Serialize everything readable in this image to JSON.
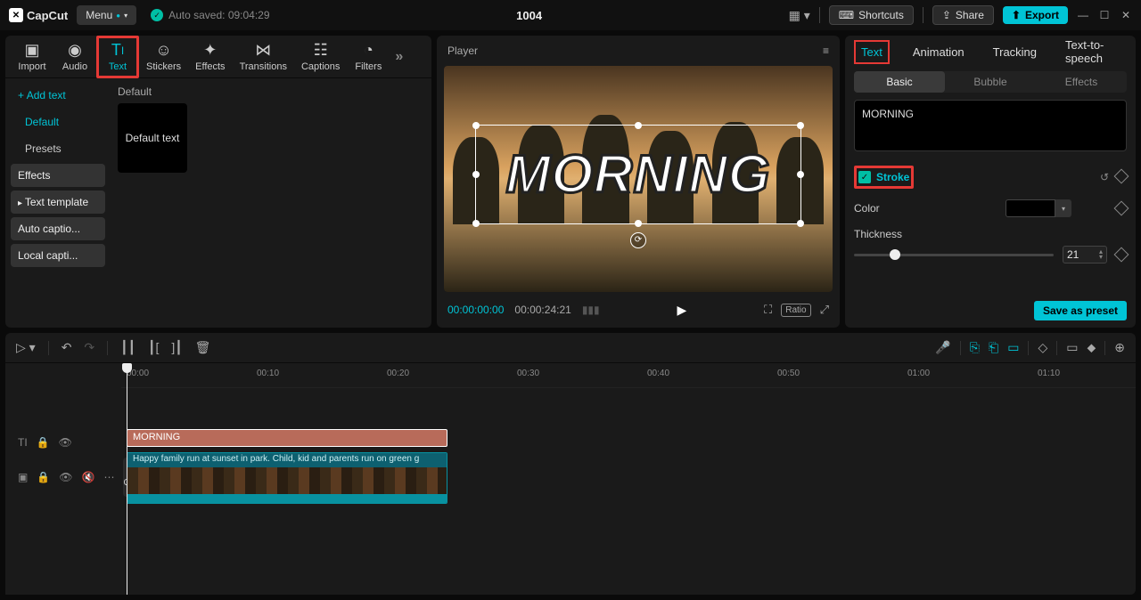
{
  "app": {
    "name": "CapCut",
    "menu_label": "Menu",
    "autosave_label": "Auto saved: 09:04:29",
    "project_title": "1004",
    "shortcuts_label": "Shortcuts",
    "share_label": "Share",
    "export_label": "Export"
  },
  "media_tabs": {
    "import": "Import",
    "audio": "Audio",
    "text": "Text",
    "stickers": "Stickers",
    "effects": "Effects",
    "transitions": "Transitions",
    "captions": "Captions",
    "filters": "Filters"
  },
  "left_sidebar": {
    "add_text": "Add text",
    "default": "Default",
    "presets": "Presets",
    "effects": "Effects",
    "text_template": "Text template",
    "auto_captions": "Auto captio...",
    "local_captions": "Local capti..."
  },
  "left_content": {
    "section_label": "Default",
    "preset_label": "Default text"
  },
  "player": {
    "label": "Player",
    "overlay_text": "MORNING",
    "time_current": "00:00:00:00",
    "time_total": "00:00:24:21",
    "ratio_label": "Ratio"
  },
  "props": {
    "tabs": {
      "text": "Text",
      "animation": "Animation",
      "tracking": "Tracking",
      "tts": "Text-to-speech"
    },
    "subtabs": {
      "basic": "Basic",
      "bubble": "Bubble",
      "effects": "Effects"
    },
    "text_value": "MORNING",
    "stroke_label": "Stroke",
    "color_label": "Color",
    "thickness_label": "Thickness",
    "thickness_value": "21",
    "save_preset_label": "Save as preset"
  },
  "timeline": {
    "ticks": [
      "00:00",
      "00:10",
      "00:20",
      "00:30",
      "00:40",
      "00:50",
      "01:00",
      "01:10"
    ],
    "text_clip_label": "MORNING",
    "media_clip_label": "Happy family run at sunset in park. Child, kid and parents run on green g",
    "cover_label": "Cover"
  }
}
